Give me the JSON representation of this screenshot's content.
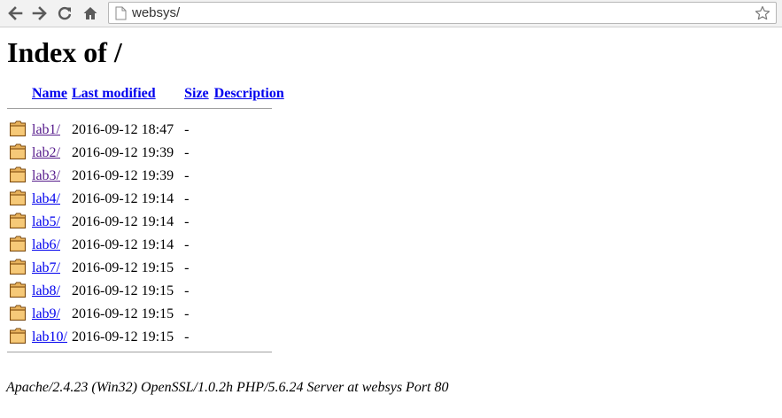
{
  "browser": {
    "url": "websys/",
    "icons": {
      "back": "back-arrow-icon",
      "forward": "forward-arrow-icon",
      "reload": "reload-icon",
      "home": "home-icon",
      "page": "page-icon",
      "bookmark": "star-icon"
    }
  },
  "page": {
    "title": "Index of /",
    "columns": {
      "name": "Name",
      "last_modified": "Last modified",
      "size": "Size",
      "description": "Description"
    },
    "entries": [
      {
        "name": "lab1/",
        "modified": "2016-09-12 18:47",
        "size": "-",
        "description": "",
        "visited": true
      },
      {
        "name": "lab2/",
        "modified": "2016-09-12 19:39",
        "size": "-",
        "description": "",
        "visited": true
      },
      {
        "name": "lab3/",
        "modified": "2016-09-12 19:39",
        "size": "-",
        "description": "",
        "visited": true
      },
      {
        "name": "lab4/",
        "modified": "2016-09-12 19:14",
        "size": "-",
        "description": "",
        "visited": false
      },
      {
        "name": "lab5/",
        "modified": "2016-09-12 19:14",
        "size": "-",
        "description": "",
        "visited": false
      },
      {
        "name": "lab6/",
        "modified": "2016-09-12 19:14",
        "size": "-",
        "description": "",
        "visited": false
      },
      {
        "name": "lab7/",
        "modified": "2016-09-12 19:15",
        "size": "-",
        "description": "",
        "visited": false
      },
      {
        "name": "lab8/",
        "modified": "2016-09-12 19:15",
        "size": "-",
        "description": "",
        "visited": false
      },
      {
        "name": "lab9/",
        "modified": "2016-09-12 19:15",
        "size": "-",
        "description": "",
        "visited": false
      },
      {
        "name": "lab10/",
        "modified": "2016-09-12 19:15",
        "size": "-",
        "description": "",
        "visited": false
      }
    ],
    "server_signature": "Apache/2.4.23 (Win32) OpenSSL/1.0.2h PHP/5.6.24 Server at websys Port 80"
  },
  "colors": {
    "link": "#0000ee",
    "visited_link": "#551a8b",
    "folder_fill": "#e8b25c",
    "folder_outline": "#7a4a10"
  }
}
